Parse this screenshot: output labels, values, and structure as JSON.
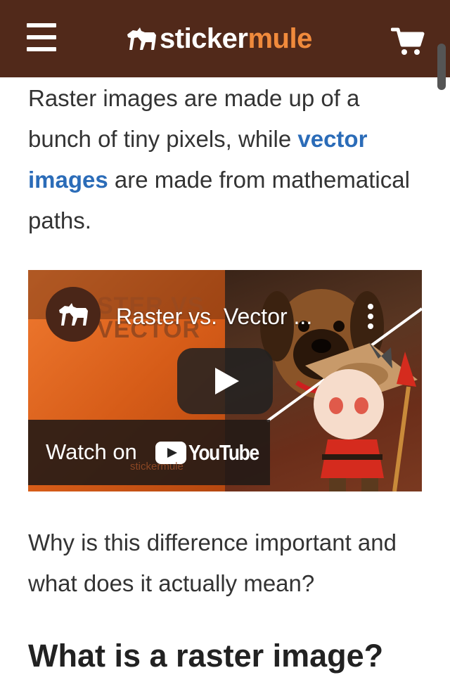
{
  "header": {
    "logo_part1": "sticker",
    "logo_part2": "mule",
    "menu_icon": "hamburger-menu-icon",
    "cart_icon": "shopping-cart-icon"
  },
  "article": {
    "para1_a": "Raster images are made up of a bunch of tiny pixels, while ",
    "para1_link": "vector images",
    "para1_b": " are made from mathematical paths.",
    "para2": "Why is this difference important and what does it actually mean?",
    "heading": "What is a raster image?"
  },
  "video": {
    "title": "Raster vs. Vector ...",
    "background_title_line1": "STER VS",
    "background_title_line2": "VECTOR",
    "watch_on": "Watch on",
    "youtube": "YouTube",
    "watermark": "stickermule"
  },
  "colors": {
    "header_bg": "#51291a",
    "brand_orange": "#f08a3c",
    "link_blue": "#2b6cb8"
  }
}
